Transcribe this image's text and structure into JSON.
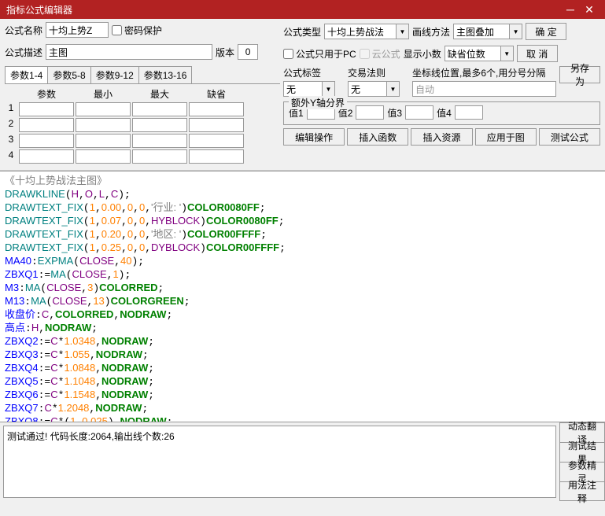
{
  "window": {
    "title": "指标公式编辑器"
  },
  "labels": {
    "formula_name": "公式名称",
    "password": "密码保护",
    "formula_type": "公式类型",
    "draw_method": "画线方法",
    "formula_desc": "公式描述",
    "version": "版本",
    "pc_only": "公式只用于PC",
    "cloud": "云公式",
    "show_decimals": "显示小数",
    "default_digits": "缺省位数",
    "formula_tag": "公式标签",
    "trade_rule": "交易法则",
    "cursor_pos": "坐标线位置,最多6个,用分号分隔",
    "auto": "自动",
    "extra_y": "额外Y轴分界",
    "val1": "值1",
    "val2": "值2",
    "val3": "值3",
    "val4": "值4"
  },
  "fields": {
    "name": "十均上势Z",
    "desc": "主图",
    "version": "0",
    "type": "十均上势战法",
    "draw": "主图叠加",
    "tag": "无",
    "rule": "无"
  },
  "buttons": {
    "ok": "确 定",
    "cancel": "取 消",
    "saveas": "另存为",
    "edit_op": "编辑操作",
    "ins_func": "插入函数",
    "ins_res": "插入资源",
    "apply": "应用于图",
    "test": "测试公式",
    "dyn_trans": "动态翻译",
    "test_result": "测试结果",
    "param_wiz": "参数精灵",
    "usage": "用法注释"
  },
  "param_tabs": [
    "参数1-4",
    "参数5-8",
    "参数9-12",
    "参数13-16"
  ],
  "param_headers": [
    "参数",
    "最小",
    "最大",
    "缺省"
  ],
  "param_rows": [
    "1",
    "2",
    "3",
    "4"
  ],
  "status": "测试通过! 代码长度:2064,输出线个数:26",
  "code_title": "《十均上势战法主图》"
}
